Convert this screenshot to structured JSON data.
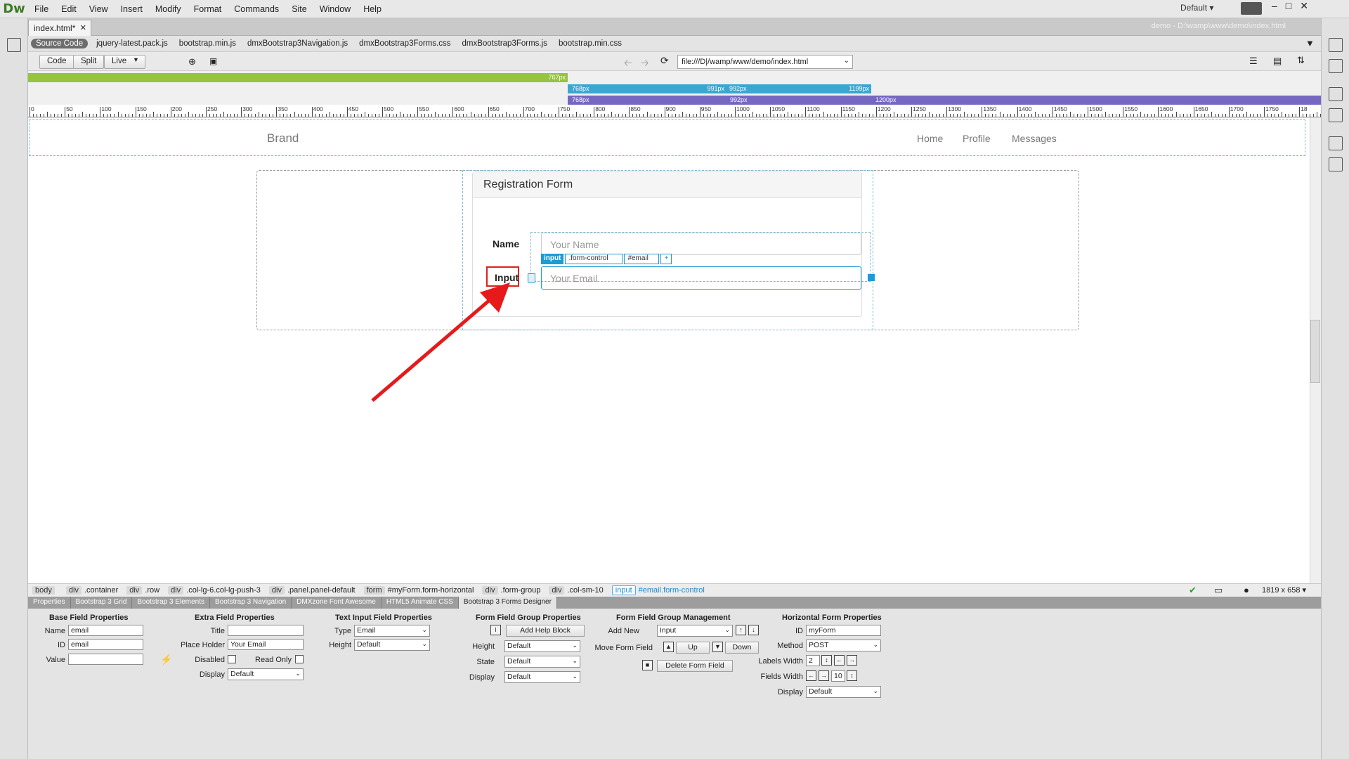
{
  "app": {
    "logo": "Dw",
    "workspace": "Default ▾"
  },
  "menu": [
    "File",
    "Edit",
    "View",
    "Insert",
    "Modify",
    "Format",
    "Commands",
    "Site",
    "Window",
    "Help"
  ],
  "document": {
    "tab": "index.html*",
    "path": "demo - D:\\wamp\\www\\demo\\index.html"
  },
  "related_files": [
    "Source Code",
    "jquery-latest.pack.js",
    "bootstrap.min.js",
    "dmxBootstrap3Navigation.js",
    "dmxBootstrap3Forms.css",
    "dmxBootstrap3Forms.js",
    "bootstrap.min.css"
  ],
  "toolbar": {
    "code": "Code",
    "split": "Split",
    "live": "Live",
    "url": "file:///D|/wamp/www/demo/index.html"
  },
  "media_queries": {
    "row1": [
      "767px",
      "768px",
      "991px",
      "992px",
      "1199px"
    ],
    "row2": [
      "768px",
      "992px",
      "1200px"
    ]
  },
  "ruler_labels": [
    "0",
    "50",
    "100",
    "150",
    "200",
    "250",
    "300",
    "350",
    "400",
    "450",
    "500",
    "550",
    "600",
    "650",
    "700",
    "750",
    "800",
    "850",
    "900",
    "950",
    "1000",
    "1050",
    "1100",
    "1150",
    "1200",
    "1250",
    "1300",
    "1350",
    "1400",
    "1450",
    "1500",
    "1550",
    "1600",
    "1650",
    "1700",
    "1750",
    "18"
  ],
  "page": {
    "brand": "Brand",
    "nav": [
      "Home",
      "Profile",
      "Messages"
    ],
    "panel_title": "Registration Form",
    "name_label": "Name",
    "name_placeholder": "Your Name",
    "email_label": "Input",
    "email_placeholder": "Your Email",
    "hud": {
      "tag": "input",
      "class": ".form-control",
      "id": "#email",
      "add": "+"
    }
  },
  "tag_selector": [
    {
      "tag": "body",
      "cls": ""
    },
    {
      "tag": "div",
      "cls": ".container"
    },
    {
      "tag": "div",
      "cls": ".row"
    },
    {
      "tag": "div",
      "cls": ".col-lg-6.col-lg-push-3"
    },
    {
      "tag": "div",
      "cls": ".panel.panel-default"
    },
    {
      "tag": "form",
      "cls": "#myForm.form-horizontal"
    },
    {
      "tag": "div",
      "cls": ".form-group"
    },
    {
      "tag": "div",
      "cls": ".col-sm-10"
    }
  ],
  "tag_selected": {
    "tag": "input",
    "cls": "#email.form-control"
  },
  "window_size": "1819 x 658 ▾",
  "panel_tabs": [
    "Properties",
    "Bootstrap 3 Grid",
    "Bootstrap 3 Elements",
    "Bootstrap 3 Navigation",
    "DMXzone Font Awesome",
    "HTML5 Animate CSS",
    "Bootstrap 3 Forms Designer"
  ],
  "props": {
    "base": {
      "title": "Base Field Properties",
      "name_l": "Name",
      "name_v": "email",
      "id_l": "ID",
      "id_v": "email",
      "value_l": "Value",
      "value_v": ""
    },
    "extra": {
      "title": "Extra Field Properties",
      "title_l": "Title",
      "title_v": "",
      "ph_l": "Place Holder",
      "ph_v": "Your Email",
      "disabled_l": "Disabled",
      "readonly_l": "Read Only",
      "display_l": "Display",
      "display_v": "Default"
    },
    "text": {
      "title": "Text Input Field Properties",
      "type_l": "Type",
      "type_v": "Email",
      "height_l": "Height",
      "height_v": "Default"
    },
    "group": {
      "title": "Form Field Group Properties",
      "help": "Add Help Block",
      "height_l": "Height",
      "height_v": "Default",
      "state_l": "State",
      "state_v": "Default",
      "display_l": "Display",
      "display_v": "Default"
    },
    "mgmt": {
      "title": "Form Field Group Management",
      "addnew_l": "Add New",
      "addnew_v": "Input",
      "move_l": "Move Form Field",
      "up": "Up",
      "down": "Down",
      "delete": "Delete Form Field"
    },
    "horiz": {
      "title": "Horizontal Form Properties",
      "id_l": "ID",
      "id_v": "myForm",
      "method_l": "Method",
      "method_v": "POST",
      "lw_l": "Labels Width",
      "lw_v": "2",
      "fw_l": "Fields Width",
      "fw_v": "10",
      "display_l": "Display",
      "display_v": "Default"
    }
  }
}
